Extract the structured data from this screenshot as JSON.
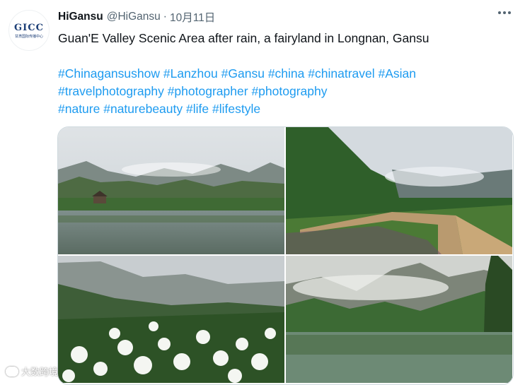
{
  "author": {
    "display_name": "HiGansu",
    "handle": "@HiGansu",
    "date": "10月11日",
    "avatar_logo_text": "GICC",
    "avatar_logo_subtext": "甘肃国际传播中心"
  },
  "tweet": {
    "text": "Guan'E Valley Scenic Area after rain, a fairyland in Longnan, Gansu",
    "hashtag_lines": [
      [
        "#Chinagansushow",
        "#Lanzhou",
        "#Gansu",
        "#china",
        "#chinatravel",
        "#Asian"
      ],
      [
        "#travelphotography",
        "#photographer",
        "#photography"
      ],
      [
        "#nature",
        "#naturebeauty",
        "#life",
        "#lifestyle"
      ]
    ]
  },
  "media": {
    "photos": [
      {
        "icon": "lake-pavilion-photo"
      },
      {
        "icon": "boardwalk-meadow-photo"
      },
      {
        "icon": "white-flowers-photo"
      },
      {
        "icon": "misty-lake-photo"
      }
    ]
  },
  "watermark": {
    "text": "大数跨境"
  },
  "colors": {
    "hashtag": "#1d9bf0",
    "secondary_text": "#536471",
    "border": "#cfd9de"
  }
}
